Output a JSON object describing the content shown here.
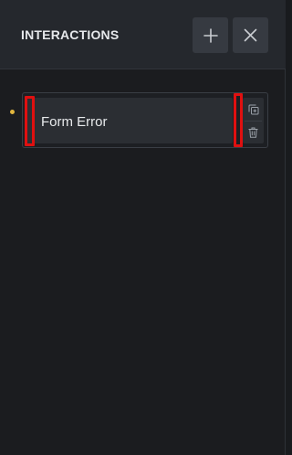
{
  "header": {
    "title": "INTERACTIONS",
    "add_icon": "plus-icon",
    "close_icon": "close-icon"
  },
  "interactions": [
    {
      "label": "Form Error",
      "status_color": "#e2b63e",
      "actions": [
        "duplicate-icon",
        "trash-icon"
      ]
    }
  ],
  "colors": {
    "accent_dot": "#e2b63e",
    "highlight": "#e01010",
    "panel_bg": "#1b1c1f",
    "header_bg": "#25282d"
  }
}
